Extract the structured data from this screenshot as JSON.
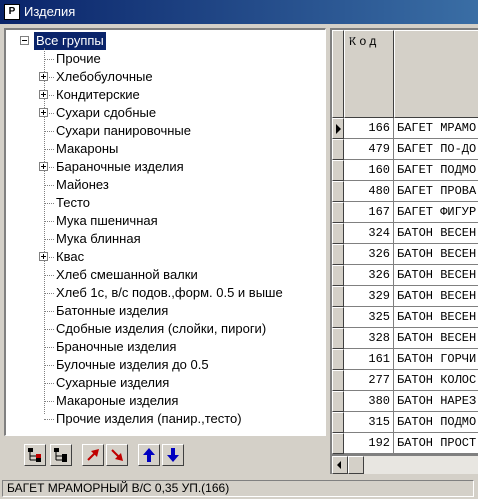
{
  "window": {
    "title": "Изделия",
    "app_icon": "app-icon"
  },
  "tree": {
    "root": "Все группы",
    "items": [
      {
        "label": "Прочие",
        "expandable": false
      },
      {
        "label": "Хлебобулочные",
        "expandable": true
      },
      {
        "label": "Кондитерские",
        "expandable": true
      },
      {
        "label": "Сухари сдобные",
        "expandable": true
      },
      {
        "label": "Сухари панировочные",
        "expandable": false
      },
      {
        "label": "Макароны",
        "expandable": false
      },
      {
        "label": "Бараночные изделия",
        "expandable": true
      },
      {
        "label": "Майонез",
        "expandable": false
      },
      {
        "label": "Тесто",
        "expandable": false
      },
      {
        "label": "Мука пшеничная",
        "expandable": false
      },
      {
        "label": "Мука блинная",
        "expandable": false
      },
      {
        "label": "Квас",
        "expandable": true
      },
      {
        "label": "Хлеб смешанной валки",
        "expandable": false
      },
      {
        "label": "Хлеб 1с, в/с подов.,форм. 0.5 и выше",
        "expandable": false
      },
      {
        "label": "Батонные изделия",
        "expandable": false
      },
      {
        "label": "Сдобные изделия (слойки, пироги)",
        "expandable": false
      },
      {
        "label": "Браночные изделия",
        "expandable": false
      },
      {
        "label": "Булочные изделия до 0.5",
        "expandable": false
      },
      {
        "label": "Сухарные изделия",
        "expandable": false
      },
      {
        "label": "Макароные изделия",
        "expandable": false
      },
      {
        "label": "Прочие изделия (панир.,тесто)",
        "expandable": false
      }
    ]
  },
  "toolbar": {
    "buttons": [
      {
        "name": "add-group-button",
        "icon": "tree-add-icon"
      },
      {
        "name": "tree-structure-button",
        "icon": "tree-structure-icon"
      },
      {
        "name": "move-out-button",
        "icon": "red-arrow-up-right-icon"
      },
      {
        "name": "move-in-button",
        "icon": "red-arrow-down-right-icon"
      },
      {
        "name": "move-up-button",
        "icon": "blue-arrow-up-icon"
      },
      {
        "name": "move-down-button",
        "icon": "blue-arrow-down-icon"
      }
    ]
  },
  "grid": {
    "columns": [
      "Код",
      ""
    ],
    "rows": [
      {
        "kod": "166",
        "name": "БАГЕТ МРАМО"
      },
      {
        "kod": "479",
        "name": "БАГЕТ ПО-ДО"
      },
      {
        "kod": "160",
        "name": "БАГЕТ ПОДМО"
      },
      {
        "kod": "480",
        "name": "БАГЕТ ПРОВА"
      },
      {
        "kod": "167",
        "name": "БАГЕТ ФИГУР"
      },
      {
        "kod": "324",
        "name": "БАТОН ВЕСЕН"
      },
      {
        "kod": "326",
        "name": "БАТОН ВЕСЕН"
      },
      {
        "kod": "326",
        "name": "БАТОН ВЕСЕН"
      },
      {
        "kod": "329",
        "name": "БАТОН ВЕСЕН"
      },
      {
        "kod": "325",
        "name": "БАТОН ВЕСЕН"
      },
      {
        "kod": "328",
        "name": "БАТОН ВЕСЕН"
      },
      {
        "kod": "161",
        "name": "БАТОН ГОРЧИ"
      },
      {
        "kod": "277",
        "name": "БАТОН КОЛОС"
      },
      {
        "kod": "380",
        "name": "БАТОН НАРЕЗ"
      },
      {
        "kod": "315",
        "name": "БАТОН ПОДМО"
      },
      {
        "kod": "192",
        "name": "БАТОН ПРОСТ"
      }
    ],
    "current_row": 0
  },
  "status": {
    "text": "БАГЕТ МРАМОРНЫЙ В/С 0,35 УП.(166)"
  },
  "colors": {
    "selection": "#0a246a",
    "face": "#d4d0c8",
    "title_start": "#0a246a",
    "title_end": "#3a6ea5"
  }
}
